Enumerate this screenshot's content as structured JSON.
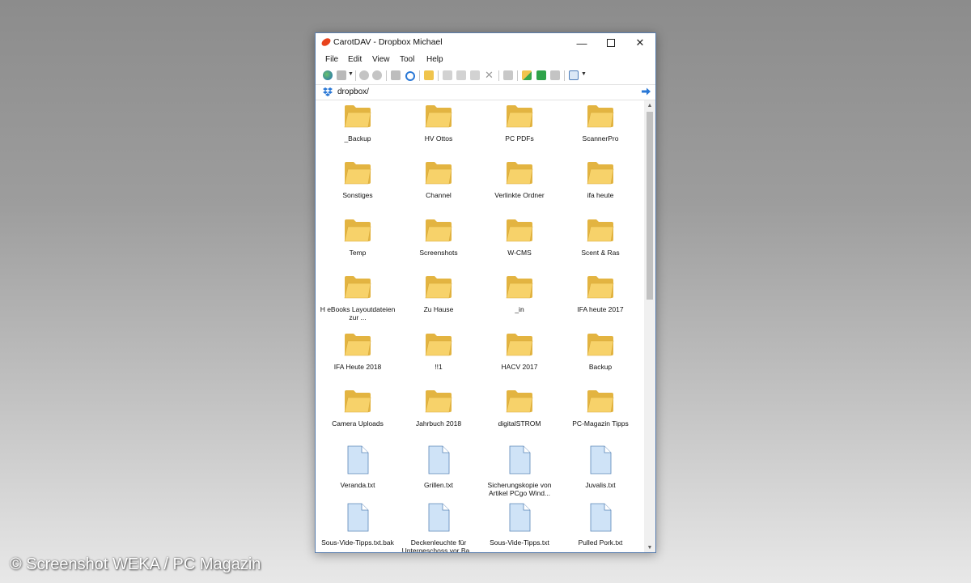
{
  "window": {
    "title": "CarotDAV - Dropbox Michael"
  },
  "menu": [
    "File",
    "Edit",
    "View",
    "Tool",
    "Help"
  ],
  "address": {
    "path": "dropbox/"
  },
  "items": [
    {
      "name": "_Backup",
      "type": "folder"
    },
    {
      "name": "HV Ottos",
      "type": "folder"
    },
    {
      "name": "PC PDFs",
      "type": "folder"
    },
    {
      "name": "ScannerPro",
      "type": "folder"
    },
    {
      "name": "Sonstiges",
      "type": "folder"
    },
    {
      "name": "Channel",
      "type": "folder"
    },
    {
      "name": "Verlinkte Ordner",
      "type": "folder"
    },
    {
      "name": "ifa heute",
      "type": "folder"
    },
    {
      "name": "Temp",
      "type": "folder"
    },
    {
      "name": "Screenshots",
      "type": "folder"
    },
    {
      "name": "W-CMS",
      "type": "folder"
    },
    {
      "name": "Scent & Ras",
      "type": "folder"
    },
    {
      "name": "H eBooks Layoutdateien zur ...",
      "type": "folder"
    },
    {
      "name": "Zu Hause",
      "type": "folder"
    },
    {
      "name": "_in",
      "type": "folder"
    },
    {
      "name": "IFA heute 2017",
      "type": "folder"
    },
    {
      "name": "IFA Heute 2018",
      "type": "folder"
    },
    {
      "name": "!!1",
      "type": "folder"
    },
    {
      "name": "HACV 2017",
      "type": "folder"
    },
    {
      "name": "Backup",
      "type": "folder"
    },
    {
      "name": "Camera Uploads",
      "type": "folder"
    },
    {
      "name": "Jahrbuch 2018",
      "type": "folder"
    },
    {
      "name": "digitalSTROM",
      "type": "folder"
    },
    {
      "name": "PC-Magazin Tipps",
      "type": "folder"
    },
    {
      "name": "Veranda.txt",
      "type": "file"
    },
    {
      "name": "Grillen.txt",
      "type": "file"
    },
    {
      "name": "Sicherungskopie von Artikel PCgo Wind...",
      "type": "file"
    },
    {
      "name": "Juvalis.txt",
      "type": "file"
    },
    {
      "name": "Sous-Vide-Tipps.txt.bak",
      "type": "file"
    },
    {
      "name": "Deckenleuchte für Untergeschoss vor Ba...",
      "type": "file"
    },
    {
      "name": "Sous-Vide-Tipps.txt",
      "type": "file"
    },
    {
      "name": "Pulled Pork.txt",
      "type": "file"
    }
  ],
  "toolbar_icons": [
    "connect-icon",
    "disconnect-icon",
    "back-icon",
    "forward-icon",
    "up-icon",
    "refresh-icon",
    "open-folder-icon",
    "cut-icon",
    "copy-icon",
    "paste-icon",
    "delete-icon",
    "properties-icon",
    "new-folder-icon",
    "upload-icon",
    "download-icon",
    "view-mode-icon"
  ],
  "watermark": "© Screenshot WEKA / PC Magazin",
  "colors": {
    "folder": "#f7d26a",
    "folder_dark": "#e3b441",
    "file": "#cfe3f7",
    "accent": "#2a78d6"
  }
}
